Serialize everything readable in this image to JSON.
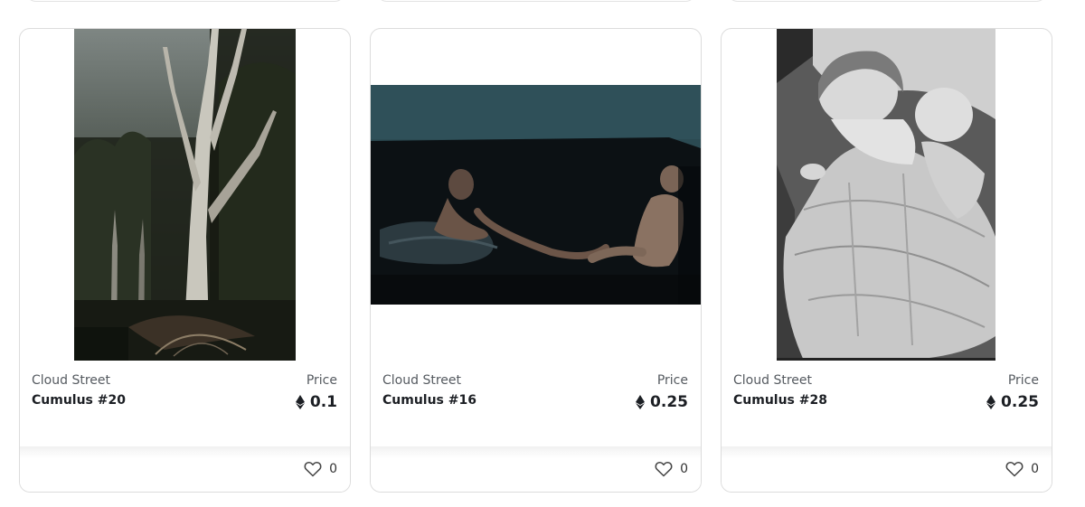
{
  "cards": [
    {
      "collection": "Cloud Street",
      "name": "Cumulus #20",
      "price_label": "Price",
      "price": "0.1",
      "likes": "0",
      "image": "forest-gum-trees-photo"
    },
    {
      "collection": "Cloud Street",
      "name": "Cumulus #16",
      "price_label": "Price",
      "price": "0.25",
      "likes": "0",
      "image": "children-on-dark-couch-photo"
    },
    {
      "collection": "Cloud Street",
      "name": "Cumulus #28",
      "price_label": "Price",
      "price": "0.25",
      "likes": "0",
      "image": "sleeping-children-bw-photo"
    }
  ],
  "icons": {
    "currency": "ethereum-icon",
    "like": "heart-outline-icon"
  },
  "colors": {
    "border": "#dcdcdc",
    "text_primary": "#1c1f24",
    "text_secondary": "#555a60"
  }
}
